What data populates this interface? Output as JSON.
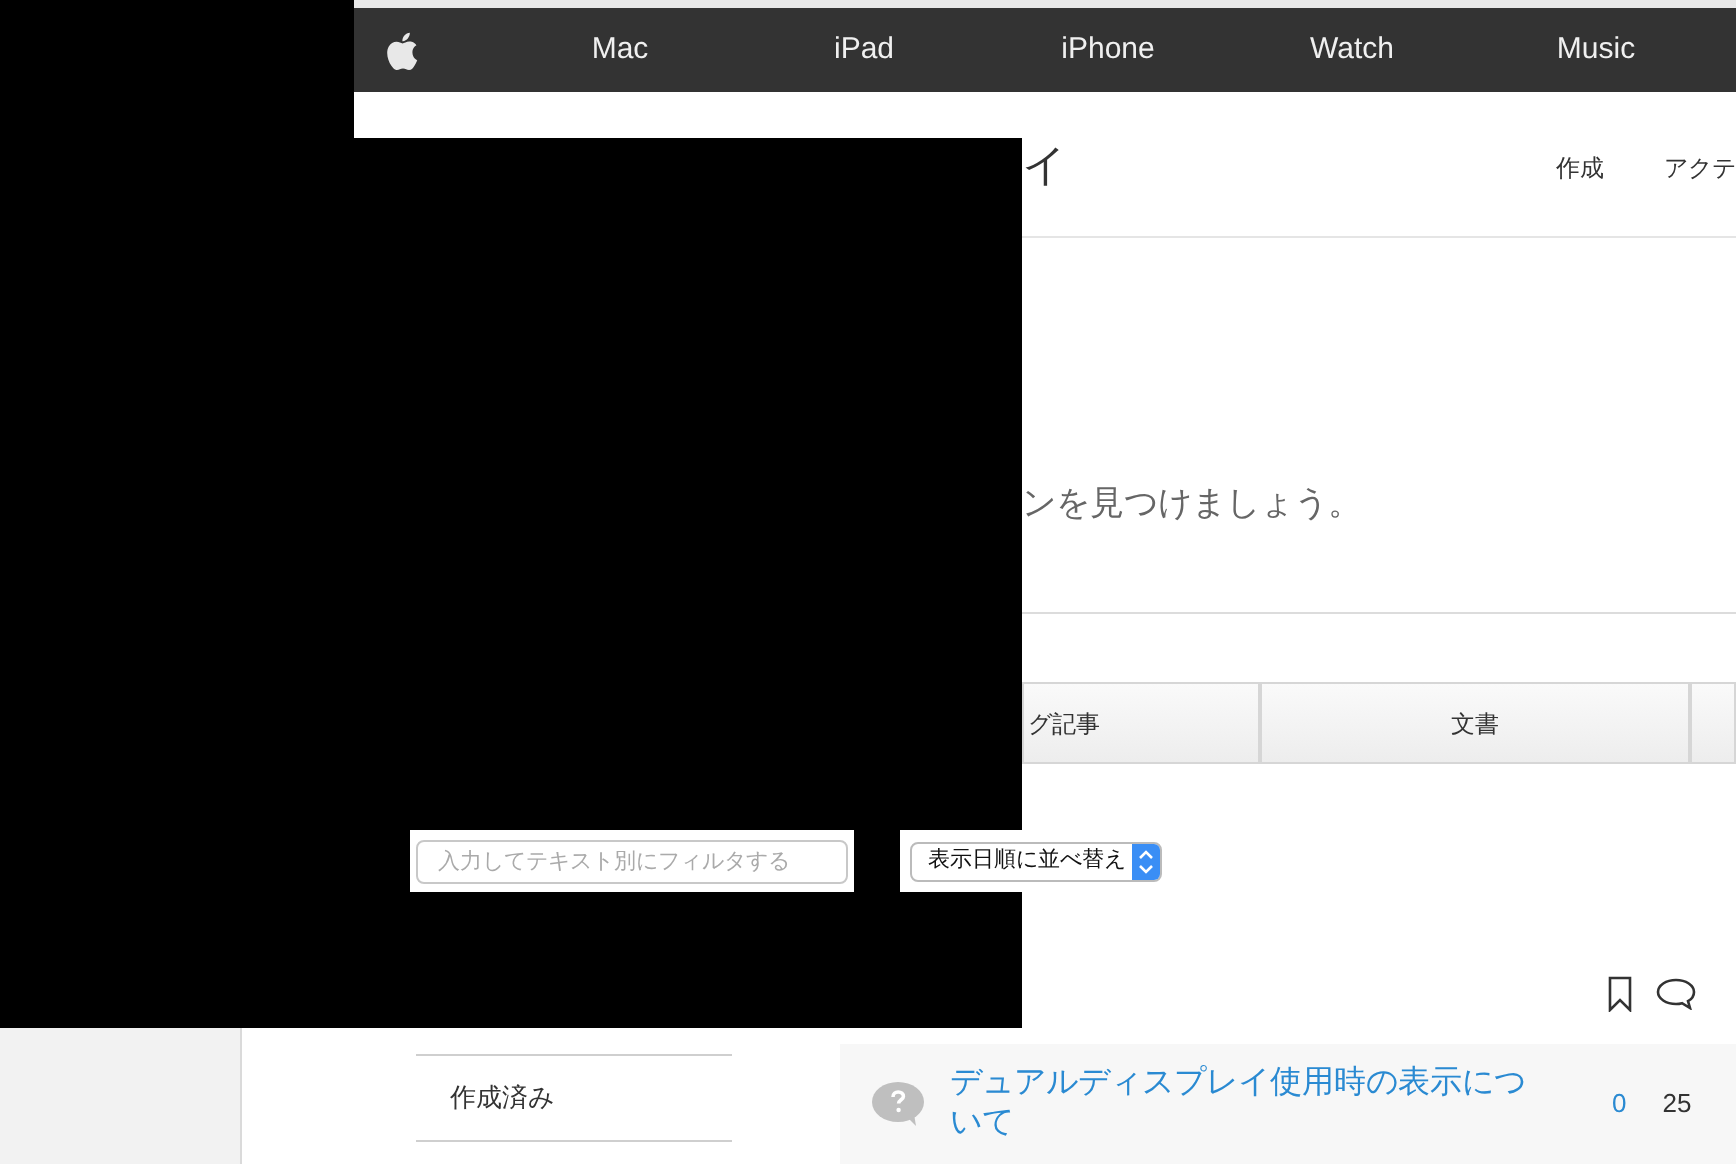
{
  "nav": {
    "items": [
      {
        "label": "Mac"
      },
      {
        "label": "iPad"
      },
      {
        "label": "iPhone"
      },
      {
        "label": "Watch"
      },
      {
        "label": "Music"
      }
    ]
  },
  "header": {
    "title": "イ",
    "links": [
      "作成",
      "アクテ"
    ]
  },
  "hero": {
    "text": "ンを見つけましょう。"
  },
  "tabs": [
    {
      "label": "グ記事",
      "selected": false
    },
    {
      "label": "文書",
      "selected": false
    }
  ],
  "filter": {
    "placeholder": "入力してテキスト別にフィルタする"
  },
  "sort": {
    "value": "表示日順に並べ替え"
  },
  "sidebar": {
    "items": [
      {
        "label": "作成済み"
      }
    ]
  },
  "threads": [
    {
      "title": "デュアルディスプレイ使用時の表示について",
      "replies": "0",
      "views": "25"
    }
  ]
}
